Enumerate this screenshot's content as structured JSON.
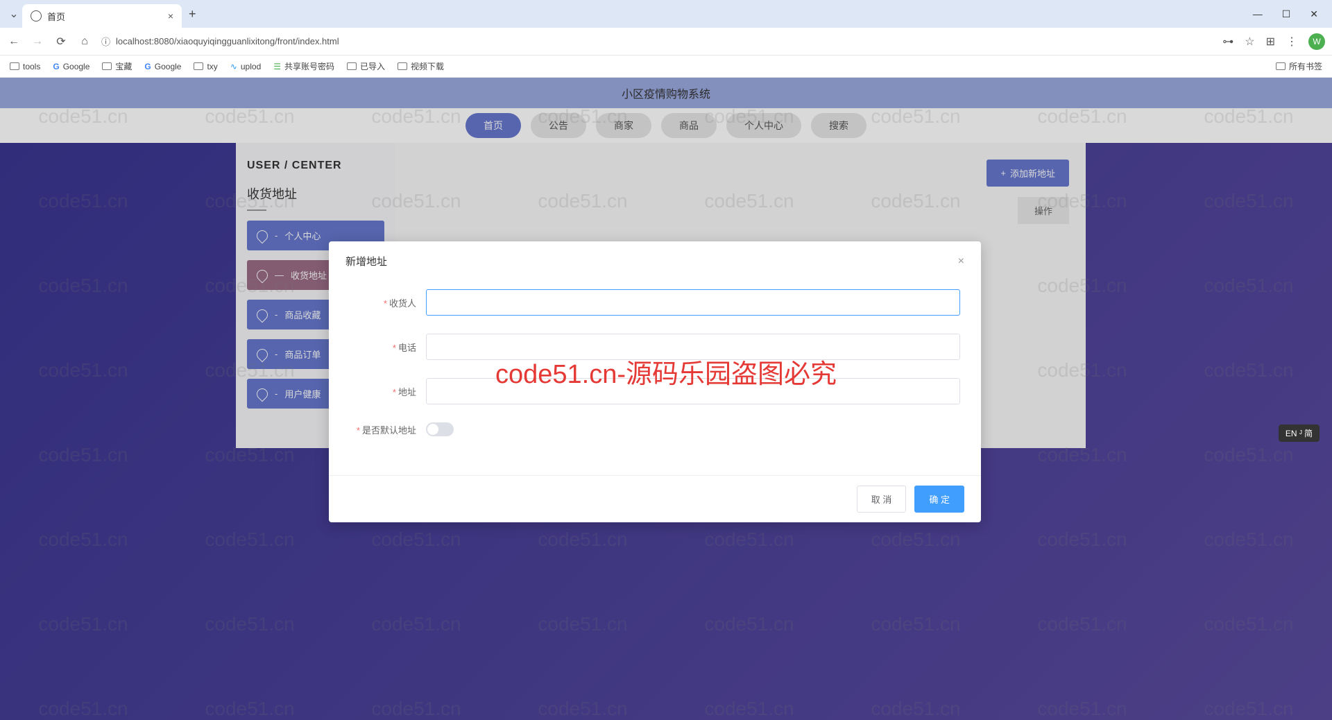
{
  "browser": {
    "tab_title": "首页",
    "url": "localhost:8080/xiaoquyiqingguanlixitong/front/index.html",
    "avatar_letter": "W",
    "bookmarks": [
      "tools",
      "Google",
      "宝藏",
      "Google",
      "txy",
      "uplod",
      "共享账号密码",
      "已导入",
      "视频下载"
    ],
    "all_bookmarks": "所有书签"
  },
  "page": {
    "header_title": "小区疫情购物系统",
    "nav": [
      "首页",
      "公告",
      "商家",
      "商品",
      "个人中心",
      "搜索"
    ]
  },
  "sidebar": {
    "title": "USER / CENTER",
    "subtitle": "收货地址",
    "items": [
      "个人中心",
      "收货地址",
      "商品收藏",
      "商品订单",
      "用户健康"
    ]
  },
  "content": {
    "add_button": "添加新地址",
    "table_col": "操作"
  },
  "modal": {
    "title": "新增地址",
    "fields": {
      "recipient": "收货人",
      "phone": "电话",
      "address": "地址",
      "default": "是否默认地址"
    },
    "cancel": "取 消",
    "confirm": "确 定"
  },
  "watermark": {
    "text": "code51.cn",
    "center": "code51.cn-源码乐园盗图必究"
  },
  "ime": "EN ᴶ 简"
}
